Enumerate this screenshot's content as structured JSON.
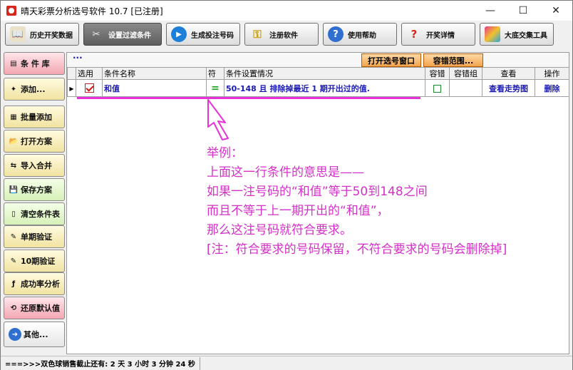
{
  "window": {
    "title": "晴天彩票分析选号软件 10.7  [已注册]",
    "minimize": "—",
    "maximize": "☐",
    "close": "✕"
  },
  "toolbar": [
    {
      "label": "历史开奖数据",
      "icon": "history-book-icon"
    },
    {
      "label": "设置过滤条件",
      "icon": "tools-icon"
    },
    {
      "label": "生成投注号码",
      "icon": "play-icon"
    },
    {
      "label": "注册软件",
      "icon": "key-icon"
    },
    {
      "label": "使用帮助",
      "icon": "help-icon"
    },
    {
      "label": "开奖详情",
      "icon": "lottery-info-icon"
    },
    {
      "label": "大底交集工具",
      "icon": "cube-tool-icon"
    }
  ],
  "sidebar": [
    {
      "label": "条 件 库",
      "icon": "▤"
    },
    {
      "label": "添加...",
      "icon": "✦"
    },
    {
      "label": "批量添加",
      "icon": "▦"
    },
    {
      "label": "打开方案",
      "icon": "📂"
    },
    {
      "label": "导入合并",
      "icon": "⇆"
    },
    {
      "label": "保存方案",
      "icon": "💾"
    },
    {
      "label": "清空条件表",
      "icon": "▯"
    },
    {
      "label": "单期验证",
      "icon": "✎"
    },
    {
      "label": "10期验证",
      "icon": "✎"
    },
    {
      "label": "成功率分析",
      "icon": "ƒ"
    },
    {
      "label": "还原默认值",
      "icon": "⟲"
    },
    {
      "label": "其他...",
      "icon": "➜"
    }
  ],
  "main": {
    "dots": "···",
    "open_window_button": "打开选号窗口",
    "tolerance_range_button": "容错范围...",
    "columns": [
      "选用",
      "条件名称",
      "符",
      "条件设置情况",
      "容错",
      "容错组",
      "查看",
      "操作"
    ],
    "row": {
      "pointer": "▶",
      "name": "和值",
      "symbol": "=",
      "setting": "50-148 且 排除掉最近 1 期开出过的值.",
      "view": "查看走势图",
      "delete": "删除"
    }
  },
  "annotation": [
    "举例：",
    "上面这一行条件的意思是——",
    "如果一注号码的“和值”等于50到148之间",
    "而且不等于上一期开出的“和值”，",
    "那么这注号码就符合要求。",
    "[注：符合要求的号码保留，不符合要求的号码会删除掉]"
  ],
  "status": {
    "countdown": "===>>>双色球销售截止还有: 2 天 3 小时 3 分钟 24 秒"
  },
  "colors": {
    "annotation": "#d430c8",
    "grid_text": "#1a1ab5"
  }
}
